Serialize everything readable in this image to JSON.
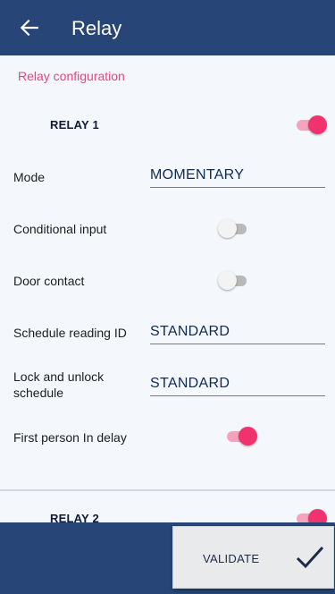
{
  "appbar": {
    "title": "Relay",
    "back_icon": "arrow-left-icon"
  },
  "section": {
    "label": "Relay configuration"
  },
  "relay1": {
    "title": "RELAY 1",
    "enabled": true,
    "mode": {
      "label": "Mode",
      "value": "MOMENTARY"
    },
    "conditional_input": {
      "label": "Conditional input",
      "enabled": false
    },
    "door_contact": {
      "label": "Door contact",
      "enabled": false
    },
    "schedule_reading": {
      "label": "Schedule reading ID",
      "value": "STANDARD"
    },
    "lock_unlock": {
      "label": "Lock and unlock schedule",
      "value": "STANDARD"
    },
    "first_person": {
      "label": "First person In delay",
      "enabled": true
    }
  },
  "relay2": {
    "title": "RELAY 2",
    "enabled": true
  },
  "footer": {
    "validate_label": "VALIDATE",
    "check_icon": "checkmark-icon"
  },
  "colors": {
    "primary": "#274576",
    "accent": "#f0336f",
    "accent_light": "#f7a3c0",
    "section_label": "#e8457d"
  }
}
